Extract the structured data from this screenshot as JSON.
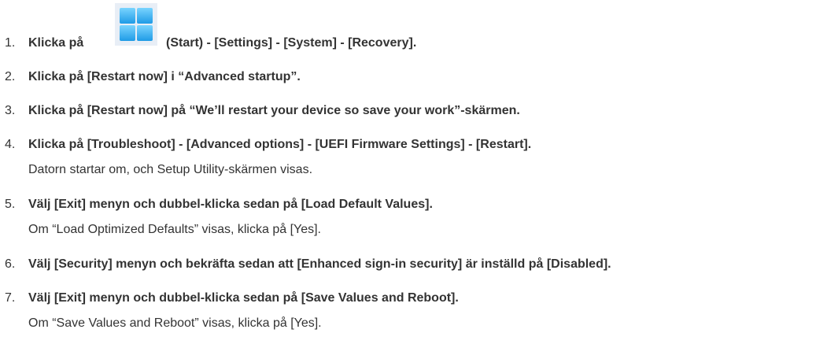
{
  "steps": [
    {
      "num": "1.",
      "pre": "Klicka på",
      "post": "(Start) - [Settings] - [System] - [Recovery]."
    },
    {
      "num": "2.",
      "text": "Klicka på [Restart now] i “Advanced startup”."
    },
    {
      "num": "3.",
      "text": "Klicka på [Restart now] på “We’ll restart your device so save your work”-skärmen."
    },
    {
      "num": "4.",
      "text": "Klicka på [Troubleshoot] - [Advanced options] - [UEFI Firmware Settings] - [Restart].",
      "note": "Datorn startar om, och Setup Utility-skärmen visas."
    },
    {
      "num": "5.",
      "text": "Välj [Exit] menyn och dubbel-klicka sedan på [Load Default Values].",
      "note": "Om “Load Optimized Defaults” visas, klicka på [Yes]."
    },
    {
      "num": "6.",
      "text": "Välj [Security] menyn och bekräfta sedan att [Enhanced sign-in security] är inställd på [Disabled]."
    },
    {
      "num": "7.",
      "text": "Välj [Exit] menyn och dubbel-klicka sedan på [Save Values and Reboot].",
      "note": "Om “Save Values and Reboot” visas, klicka på [Yes]."
    }
  ],
  "icons": {
    "start": "windows-start-icon"
  },
  "colors": {
    "text": "#333333",
    "icon_light": "#4cc2ff",
    "icon_dark": "#0078d4"
  }
}
